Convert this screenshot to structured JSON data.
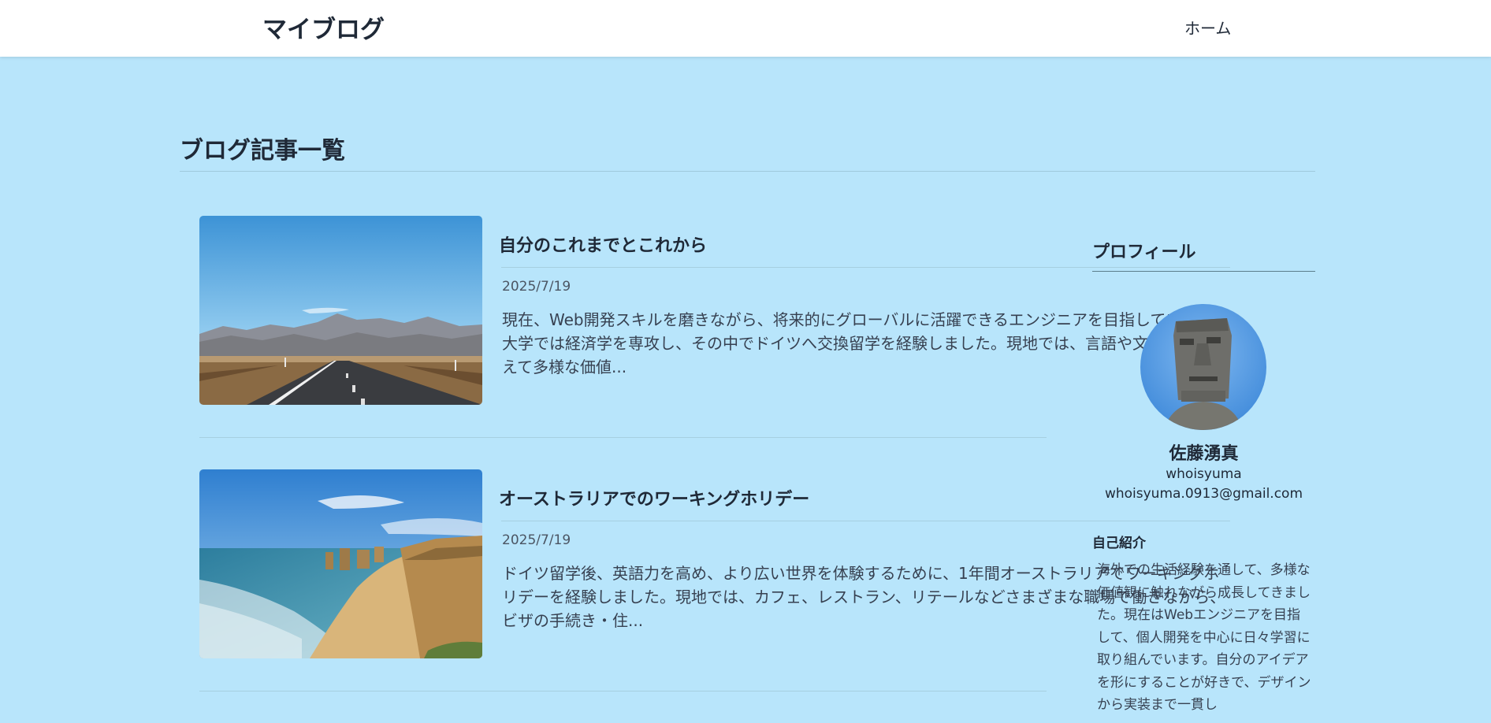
{
  "header": {
    "site_title": "マイブログ",
    "nav": {
      "home_label": "ホーム"
    }
  },
  "main": {
    "heading": "ブログ記事一覧",
    "posts": [
      {
        "title": "自分のこれまでとこれから",
        "date": "2025/7/19",
        "excerpt": "現在、Web開発スキルを磨きながら、将来的にグローバルに活躍できるエンジニアを目指しています。大学では経済学を専攻し、その中でドイツへ交換留学を経験しました。現地では、言語や文化の壁を越えて多様な価値..."
      },
      {
        "title": "オーストラリアでのワーキングホリデー",
        "date": "2025/7/19",
        "excerpt": "ドイツ留学後、英語力を高め、より広い世界を体験するために、1年間オーストラリアでワーキングホリデーを経験しました。現地では、カフェ、レストラン、リテールなどさまざまな職場で働きながら、ビザの手続き・住..."
      }
    ]
  },
  "sidebar": {
    "profile_heading": "プロフィール",
    "name": "佐藤湧真",
    "handle": "whoisyuma",
    "email": "whoisyuma.0913@gmail.com",
    "intro_heading": "自己紹介",
    "intro_text": "海外での生活経験を通して、多様な価値観に触れながら成長してきました。現在はWebエンジニアを目指して、個人開発を中心に日々学習に取り組んでいます。自分のアイデアを形にすることが好きで、デザインから実装まで一貫し"
  }
}
